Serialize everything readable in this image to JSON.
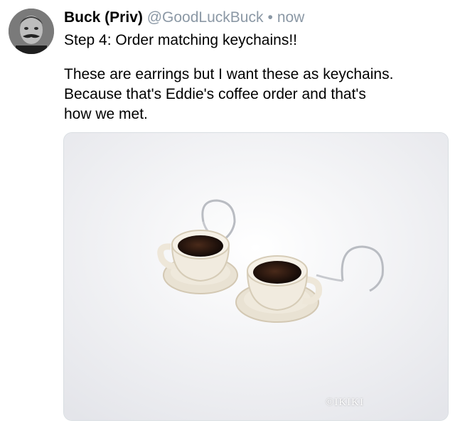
{
  "tweet": {
    "display_name": "Buck (Priv)",
    "handle": "@GoodLuckBuck",
    "separator": "•",
    "time": "now",
    "first_line": "Step 4: Order matching keychains!!",
    "body": "These are earrings but I want these as keychains.\nBecause that's Eddie's coffee order and that's\nhow we met.",
    "avatar_icon": "profile-photo",
    "media": {
      "description_icon": "coffee-cup-earrings-photo",
      "watermark": "©IKIKI"
    }
  },
  "colors": {
    "text": "#000000",
    "muted": "#8b98a5",
    "media_border": "#d9dee2"
  }
}
